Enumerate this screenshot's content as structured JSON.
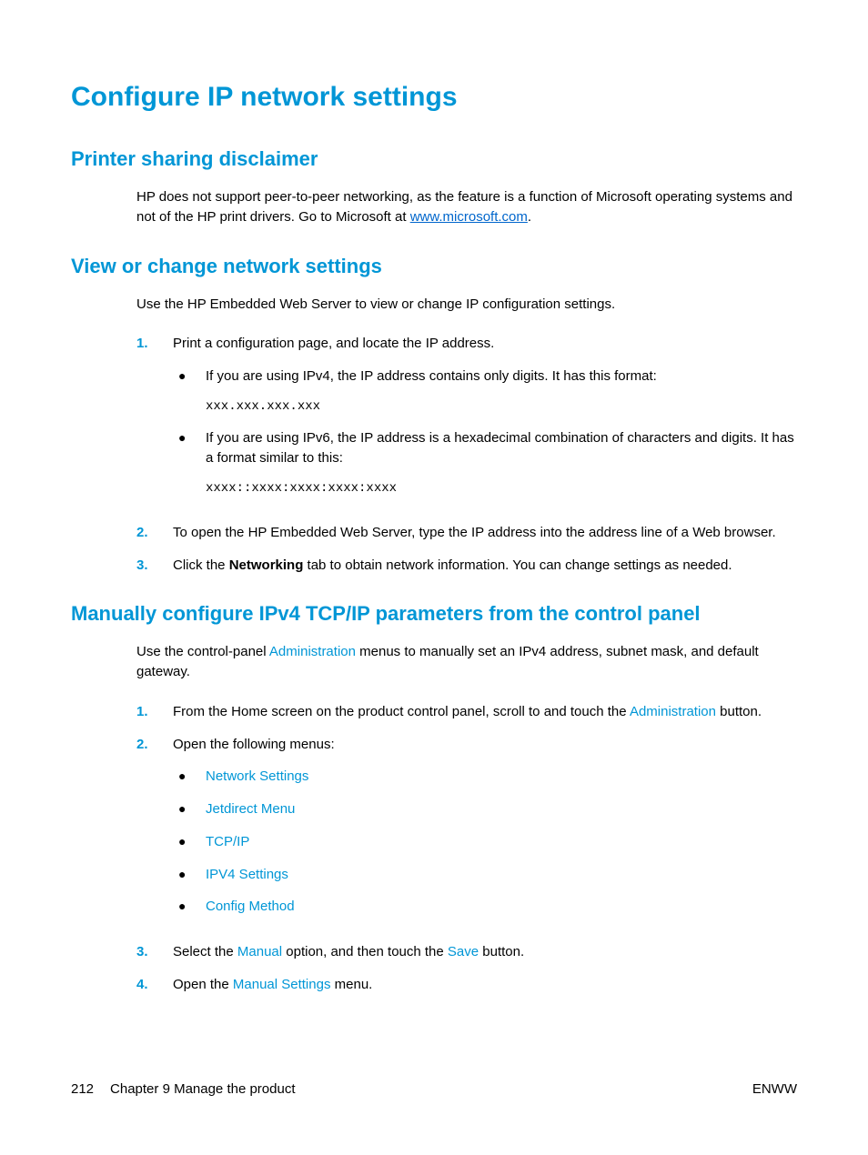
{
  "title": "Configure IP network settings",
  "sections": {
    "disclaimer": {
      "heading": "Printer sharing disclaimer",
      "body_pre": "HP does not support peer-to-peer networking, as the feature is a function of Microsoft operating systems and not of the HP print drivers. Go to Microsoft at ",
      "link_text": "www.microsoft.com",
      "body_post": "."
    },
    "view": {
      "heading": "View or change network settings",
      "intro": "Use the HP Embedded Web Server to view or change IP configuration settings.",
      "step1": "Print a configuration page, and locate the IP address.",
      "step1_b1": "If you are using IPv4, the IP address contains only digits. It has this format:",
      "step1_b1_code": "xxx.xxx.xxx.xxx",
      "step1_b2": "If you are using IPv6, the IP address is a hexadecimal combination of characters and digits. It has a format similar to this:",
      "step1_b2_code": "xxxx::xxxx:xxxx:xxxx:xxxx",
      "step2": "To open the HP Embedded Web Server, type the IP address into the address line of a Web browser.",
      "step3_pre": "Click the ",
      "step3_bold": "Networking",
      "step3_post": " tab to obtain network information. You can change settings as needed."
    },
    "manual": {
      "heading": "Manually configure IPv4 TCP/IP parameters from the control panel",
      "intro_pre": "Use the control-panel ",
      "intro_ref": "Administration",
      "intro_post": " menus to manually set an IPv4 address, subnet mask, and default gateway.",
      "step1_pre": "From the Home screen on the product control panel, scroll to and touch the ",
      "step1_ref": "Administration",
      "step1_post": " button.",
      "step2": "Open the following menus:",
      "step2_menus": {
        "m1": "Network Settings",
        "m2": "Jetdirect Menu",
        "m3": "TCP/IP",
        "m4": "IPV4 Settings",
        "m5": "Config Method"
      },
      "step3_pre": "Select the ",
      "step3_ref1": "Manual",
      "step3_mid": " option, and then touch the ",
      "step3_ref2": "Save",
      "step3_post": " button.",
      "step4_pre": "Open the ",
      "step4_ref": "Manual Settings",
      "step4_post": " menu."
    }
  },
  "footer": {
    "page": "212",
    "chapter": "Chapter 9   Manage the product",
    "lang": "ENWW"
  }
}
